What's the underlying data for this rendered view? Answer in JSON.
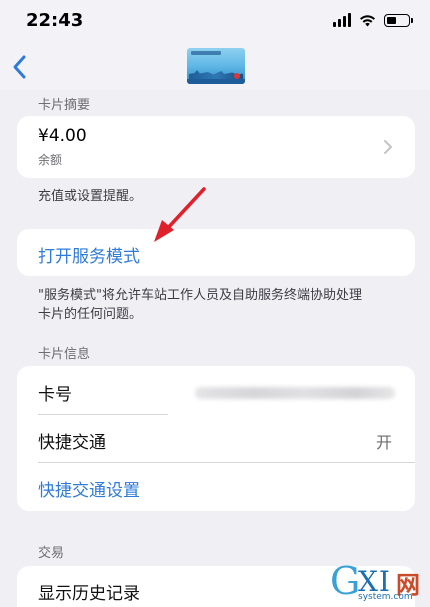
{
  "status_bar": {
    "time": "22:43"
  },
  "card_summary": {
    "section_title": "卡片摘要",
    "balance_value": "¥4.00",
    "balance_label": "余额",
    "footnote": "充值或设置提醒。"
  },
  "service_mode": {
    "link_label": "打开服务模式",
    "footnote_line1": "\"服务模式\"将允许车站工作人员及自助服务终端协助处理",
    "footnote_line2": "卡片的任何问题。"
  },
  "card_info": {
    "section_title": "卡片信息",
    "card_number_label": "卡号",
    "express_transit_label": "快捷交通",
    "express_transit_value": "开",
    "express_transit_settings_label": "快捷交通设置"
  },
  "transactions": {
    "section_title": "交易",
    "history_label": "显示历史记录"
  },
  "watermark": {
    "brand": "XI",
    "brand_g": "G",
    "brand_cn": "网",
    "url": "system.com"
  },
  "colors": {
    "link": "#2f7bd8",
    "background": "#efeff4",
    "arrow": "#e0202a"
  }
}
